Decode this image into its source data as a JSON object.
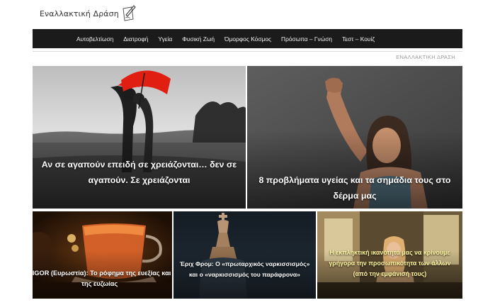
{
  "site": {
    "logo_text": "Εναλλακτική Δράση"
  },
  "nav": {
    "items": [
      {
        "label": "Αυτοβελτίωση"
      },
      {
        "label": "Διατροφή"
      },
      {
        "label": "Υγεία"
      },
      {
        "label": "Φυσική Ζωή"
      },
      {
        "label": "Όμορφος Κόσμος"
      },
      {
        "label": "Πρόσωπα – Γνώση"
      },
      {
        "label": "Τεστ – Κουίζ"
      }
    ]
  },
  "breadcrumb": "ΕΝΑΛΛΑΚΤΙΚΗ ΔΡΑΣΗ",
  "articles": {
    "love": {
      "title": "Αν σε αγαπούν επειδή σε χρειάζονται… δεν σε αγαπούν. Σε χρειάζονται"
    },
    "skin": {
      "title": "8 προβλήματα υγείας και τα σημάδια τους στο δέρμα μας"
    },
    "vigor": {
      "title": "VIGOR (Ευρωστία): Το ρόφημα της ευεξίας και της ευζωίας"
    },
    "fromm": {
      "title": "Έριχ Φρομ: Ο «πρωταρχικός ναρκισσισμός» και ο «ναρκισσισμός του παράφρονα»"
    },
    "ability": {
      "title": "Η εκπληκτική ικανότητά μας να κρίνουμε γρήγορα την προσωπικότητα των άλλων (από την εμφάνισή τους)"
    }
  },
  "colors": {
    "navbar_bg": "#1b1b1b",
    "umbrella_red": "#e01e12",
    "highlight_title": "#fff6a0"
  },
  "icons": {
    "logo": "pen-and-paper-icon"
  }
}
